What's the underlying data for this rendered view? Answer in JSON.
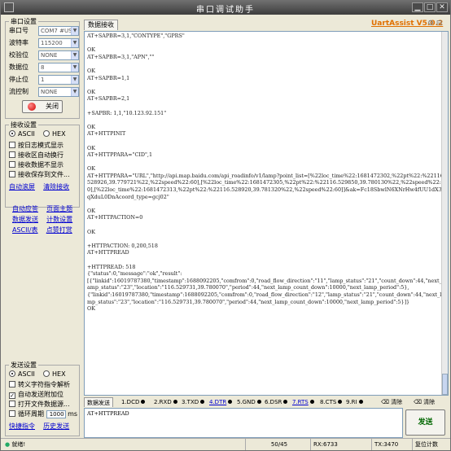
{
  "window": {
    "title": "串口调试助手",
    "controls": [
      "▁",
      "□",
      "✕"
    ]
  },
  "serial_settings": {
    "title": "串口设置",
    "fields": [
      {
        "label": "串口号",
        "value": "COM7 #USI"
      },
      {
        "label": "波特率",
        "value": "115200"
      },
      {
        "label": "校验位",
        "value": "NONE"
      },
      {
        "label": "数据位",
        "value": "8"
      },
      {
        "label": "停止位",
        "value": "1"
      },
      {
        "label": "流控制",
        "value": "NONE"
      }
    ],
    "open_button": "关闭"
  },
  "receive_settings": {
    "title": "接收设置",
    "radio_ascii": "ASCII",
    "radio_hex": "HEX",
    "checks": [
      "按日志模式显示",
      "接收区自动换行",
      "接收数据不显示",
      "接收保存到文件..."
    ],
    "link_autoscroll": "自动滚屏",
    "link_clear": "清除接收",
    "links": [
      [
        "自动应答",
        "页面主题"
      ],
      [
        "数据发送",
        "计数设置"
      ],
      [
        "ASCII/表",
        "点赞打赏"
      ]
    ]
  },
  "send_settings": {
    "title": "发送设置",
    "radio_ascii": "ASCII",
    "radio_hex": "HEX",
    "checks": [
      {
        "label": "转义字符指令解析",
        "checked": false
      },
      {
        "label": "自动发送附加位",
        "checked": true
      },
      {
        "label": "打开文件数据源...",
        "checked": false
      },
      {
        "label": "循环周期",
        "checked": false
      }
    ],
    "period_value": "1000",
    "period_unit": "ms",
    "link_shortcut": "快捷指令",
    "link_history": "历史发送"
  },
  "receive_area": {
    "tab": "数据接收",
    "brand": "UartAssist V5.0.2",
    "brand_icons": "⚙ ⊟",
    "lines": [
      "AT+SAPBR=3,1,\"CONTYPE\",\"GPRS\"",
      "",
      "OK",
      "AT+SAPBR=3,1,\"APN\",\"\"",
      "",
      "OK",
      "AT+SAPBR=1,1",
      "",
      "OK",
      "AT+SAPBR=2,1",
      "",
      "+SAPBR: 1,1,\"10.123.92.151\"",
      "",
      "OK",
      "AT+HTTPINIT",
      "",
      "OK",
      "AT+HTTPPARA=\"CID\",1",
      "",
      "OK",
      "AT+HTTPPARA=\"URL\",\"http://api.map.baidu.com/api_roadinfo/v1/lamp?point_list=[%22loc_time%22:1681472302,%22pt%22:%22116.528926,39.779721%22,%22speed%22:60],[%22loc_time%22:1681472305,%22pt%22:%22116.529850,39.780130%22,%22speed%22:60],[%22loc_time%22:1681472313,%22pt%22:%22116.528920,39.781320%22,%22speed%22:60]]&ak=Fc18SbwlN6XNrHw4fUU1dX3lqXduL0DnAcoord_type=gcj02\"",
      "",
      "OK",
      "AT+HTTPACTION=0",
      "",
      "OK",
      "",
      "+HTTPACTION: 0,200,518",
      "AT+HTTPREAD",
      "",
      "+HTTPREAD: 518",
      "{\"status\":0,\"message\":\"ok\",\"result\":",
      "[{\"linkid\":16019787380,\"timestamp\":1688092205,\"comfrom\":0,\"road_flow_direction\":\"11\",\"lamp_status\":\"21\",\"count_down\":44,\"next_lamp_status\":\"23\",\"location\":\"116.529731,39.780070\",\"period\":44,\"next_lamp_count_down\":10000,\"next_lamp_period\":5},",
      "{\"linkid\":16019787380,\"timestamp\":1688092205,\"comfrom\":0,\"road_flow_direction\":\"12\",\"lamp_status\":\"21\",\"count_down\":44,\"next_lamp_status\":\"23\",\"location\":\"116.529731,39.780070\",\"period\":44,\"next_lamp_count_down\":10000,\"next_lamp_period\":5}]}",
      "OK"
    ]
  },
  "send_area": {
    "tab": "数据发送",
    "signals": [
      "1.DCD",
      "2.RXD",
      "3.TXD",
      "4.DTR",
      "5.GND",
      "6.DSR",
      "7.RTS",
      "8.CTS",
      "9.RI"
    ],
    "clear_label": "清除",
    "clear2_label": "清除",
    "input_value": "AT+HTTPREAD",
    "send_button": "发送"
  },
  "status_bar": {
    "ready": "就绪!",
    "counter": "50/45",
    "rx": "RX:6733",
    "tx": "TX:3470",
    "reset": "复位计数"
  },
  "colors": {
    "brand": "#e07000",
    "link": "#0000d0",
    "open_led": "#d00000",
    "send_text": "#006600"
  }
}
